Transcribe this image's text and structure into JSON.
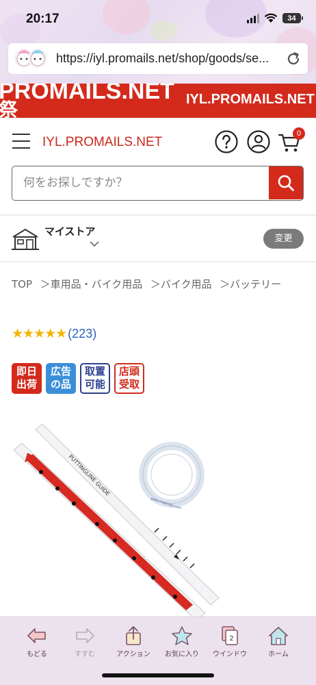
{
  "status_bar": {
    "time": "20:17",
    "battery": "34"
  },
  "browser": {
    "url": "https://iyl.promails.net/shop/goods/se..."
  },
  "banner": {
    "big_text": "PROMAILS.NET",
    "big_text_subchar": "祭",
    "small_text": "IYL.PROMAILS.NET"
  },
  "header": {
    "site_name": "IYL.PROMAILS.NET",
    "cart_count": "0"
  },
  "search": {
    "placeholder": "何をお探しですか？",
    "value": ""
  },
  "mystore": {
    "label": "マイストア",
    "change_button": "変更"
  },
  "breadcrumb": {
    "items": [
      "TOP",
      "＞車用品・バイク用品",
      "＞バイク用品",
      "＞バッテリー"
    ]
  },
  "rating": {
    "stars": "★★★★★",
    "count": "(223)"
  },
  "tags": [
    {
      "line1": "即日",
      "line2": "出荷"
    },
    {
      "line1": "広告",
      "line2": "の品"
    },
    {
      "line1": "取置",
      "line2": "可能"
    },
    {
      "line1": "店頭",
      "line2": "受取"
    }
  ],
  "product_image": {
    "guide_text": "PUTTINGLINE GUIDE",
    "ring_text": "www.mazingo.com"
  },
  "toolbar": {
    "back": "もどる",
    "forward": "すすむ",
    "action": "アクション",
    "favorites": "お気に入り",
    "windows": "ウインドウ",
    "windows_count": "2",
    "home": "ホーム"
  },
  "colors": {
    "brand_red": "#d32a1c",
    "link_blue": "#2a62b7",
    "star_gold": "#f3b500",
    "toolbar_bg": "#ece2ee"
  }
}
